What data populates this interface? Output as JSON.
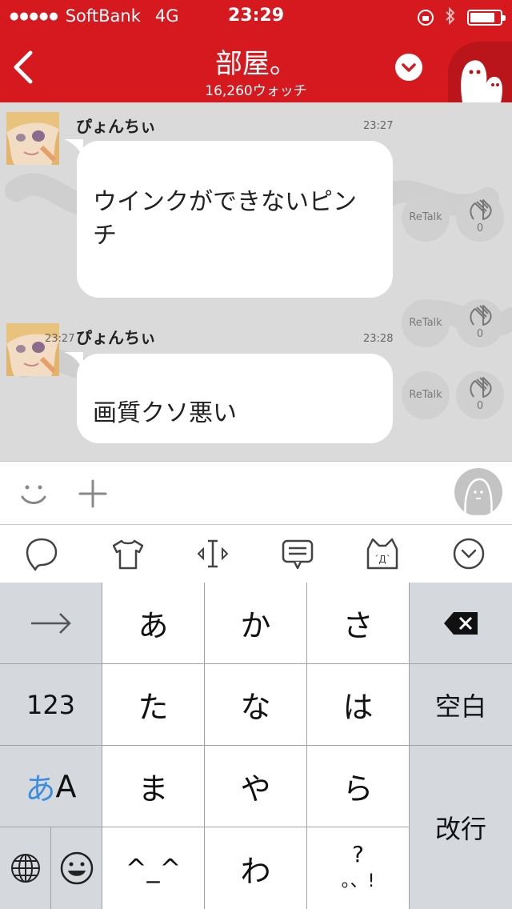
{
  "status_bar": {
    "signal_dots": "●●●●●",
    "carrier": "SoftBank",
    "network": "4G",
    "time": "23:29"
  },
  "header": {
    "title": "部屋。",
    "subtitle": "16,260ウォッチ",
    "brand_color": "#d6181f"
  },
  "messages": [
    {
      "author": "ぴょんちぃ",
      "time": "23:27",
      "lines": [
        "ウインクができないピン",
        "チ"
      ],
      "retalk_label": "ReTalk",
      "clap_count": "0"
    },
    {
      "author": "ぴょんちぃ",
      "time": "23:28",
      "overlay_time": "23:27",
      "lines": [
        "画質クソ悪い"
      ],
      "retalk_label": "ReTalk",
      "clap_count": "0"
    }
  ],
  "extra_actions": {
    "retalk_label": "ReTalk",
    "clap_count": "0"
  },
  "keyboard": {
    "keys": {
      "a": "あ",
      "ka": "か",
      "sa": "さ",
      "ta": "た",
      "na": "な",
      "ha": "は",
      "ma": "ま",
      "ya": "や",
      "ra": "ら",
      "kaomoji": "^_^",
      "wa": "わ",
      "punct_top": "?",
      "punct_bottom": "。、!",
      "numbers": "123",
      "mode_a": "あ",
      "mode_b": "A",
      "space": "空白",
      "return": "改行"
    },
    "accent_color": "#3c8de0"
  }
}
